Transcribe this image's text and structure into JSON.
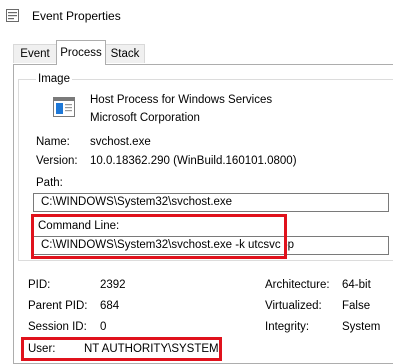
{
  "window": {
    "title": "Event Properties",
    "icon": "event-properties-icon"
  },
  "tabs": [
    {
      "label": "Event"
    },
    {
      "label": "Process"
    },
    {
      "label": "Stack"
    }
  ],
  "image": {
    "group_label": "Image",
    "description": "Host Process for Windows Services",
    "company": "Microsoft Corporation",
    "name_label": "Name:",
    "name": "svchost.exe",
    "version_label": "Version:",
    "version": "10.0.18362.290 (WinBuild.160101.0800)",
    "path_label": "Path:",
    "path": "C:\\WINDOWS\\System32\\svchost.exe",
    "cmdline_label": "Command Line:",
    "cmdline": "C:\\WINDOWS\\System32\\svchost.exe -k utcsvc -p"
  },
  "details": {
    "pid_label": "PID:",
    "pid": "2392",
    "parent_pid_label": "Parent PID:",
    "parent_pid": "684",
    "session_label": "Session ID:",
    "session": "0",
    "user_label": "User:",
    "user": "NT AUTHORITY\\SYSTEM",
    "arch_label": "Architecture:",
    "arch": "64-bit",
    "virtualized_label": "Virtualized:",
    "virtualized": "False",
    "integrity_label": "Integrity:",
    "integrity": "System"
  },
  "highlight_color": "#e0121c"
}
